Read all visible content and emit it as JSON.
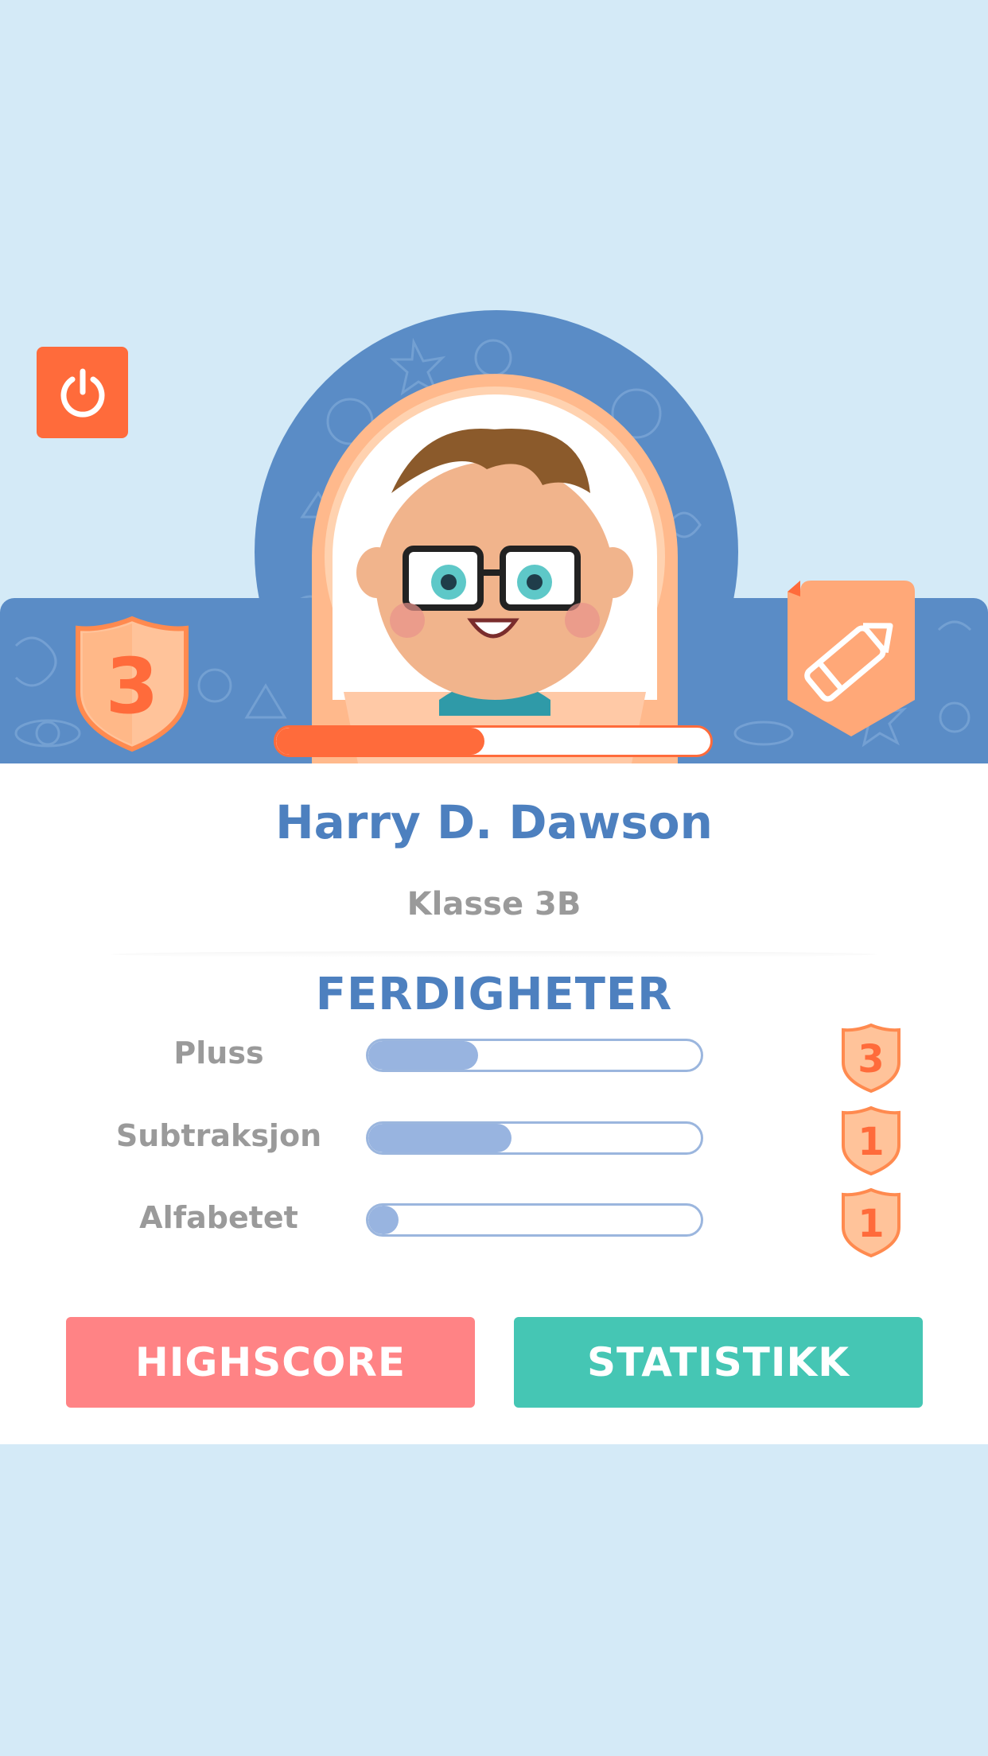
{
  "profile": {
    "name": "Harry D. Dawson",
    "class_label": "Klasse 3B",
    "level": "3",
    "xp_progress": 0.48
  },
  "skills_section": {
    "title": "FERDIGHETER",
    "items": [
      {
        "label": "Pluss",
        "progress": 0.33,
        "level": "3"
      },
      {
        "label": "Subtraksjon",
        "progress": 0.43,
        "level": "1"
      },
      {
        "label": "Alfabetet",
        "progress": 0.09,
        "level": "1"
      }
    ]
  },
  "actions": {
    "highscore_label": "HIGHSCORE",
    "statistics_label": "STATISTIKK"
  },
  "icons": {
    "power": "power-icon",
    "edit": "pencil-icon",
    "level": "shield-icon"
  },
  "colors": {
    "background": "#d4eaf7",
    "header_blue": "#5a8cc6",
    "accent_orange": "#ff6b3b",
    "title_blue": "#4d80bf",
    "highscore": "#ff8385",
    "statistics": "#45c6b4"
  }
}
